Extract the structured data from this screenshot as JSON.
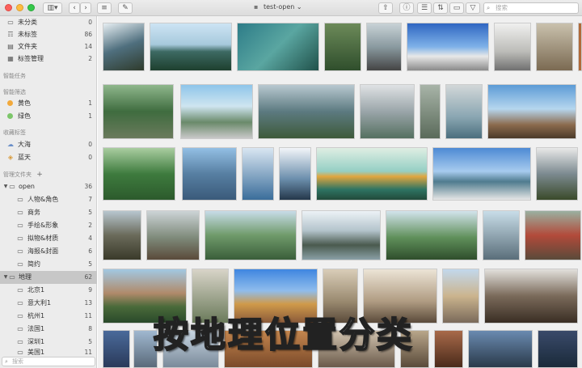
{
  "window": {
    "title": "test-open",
    "title_chevron": "⌄",
    "search_placeholder": "搜索"
  },
  "sidebar": {
    "top_items": [
      {
        "label": "未分类",
        "count": "0",
        "icon": "inbox-icon"
      },
      {
        "label": "未标签",
        "count": "86",
        "icon": "untagged-icon"
      },
      {
        "label": "文件夹",
        "count": "14",
        "icon": "folder-icon"
      },
      {
        "label": "标签管理",
        "count": "2",
        "icon": "tag-manager-icon"
      }
    ],
    "section_smart_tasks": "智能任务",
    "section_smart_filter": "智能筛选",
    "filters": [
      {
        "label": "黄色",
        "count": "1",
        "color": "#f2a93b"
      },
      {
        "label": "绿色",
        "count": "1",
        "color": "#7cc66a"
      }
    ],
    "section_fav_tags": "收藏标签",
    "fav_tags": [
      {
        "label": "大海",
        "count": "0",
        "icon": "cloud-icon"
      },
      {
        "label": "蓝天",
        "count": "0",
        "icon": "tag-icon"
      }
    ],
    "section_folders": "管理文件夹",
    "add_symbol": "+",
    "folders": [
      {
        "label": "open",
        "count": "36"
      },
      {
        "label": "人物&角色",
        "count": "7"
      },
      {
        "label": "商务",
        "count": "5"
      },
      {
        "label": "手绘&形象",
        "count": "2"
      },
      {
        "label": "拟物&材质",
        "count": "4"
      },
      {
        "label": "海报&封面",
        "count": "6"
      },
      {
        "label": "简约",
        "count": "5"
      },
      {
        "label": "地理",
        "count": "62"
      },
      {
        "label": "北京1",
        "count": "9"
      },
      {
        "label": "意大利1",
        "count": "13"
      },
      {
        "label": "杭州1",
        "count": "11"
      },
      {
        "label": "法国1",
        "count": "8"
      },
      {
        "label": "深圳1",
        "count": "5"
      },
      {
        "label": "美国1",
        "count": "11"
      }
    ],
    "search_placeholder": "搜索"
  },
  "overlay_caption": "按地理位置分类",
  "colors": {
    "sidebar_bg": "#ececec",
    "selected_row": "#c7c7c7",
    "grid_bg": "#f0f0f0"
  }
}
